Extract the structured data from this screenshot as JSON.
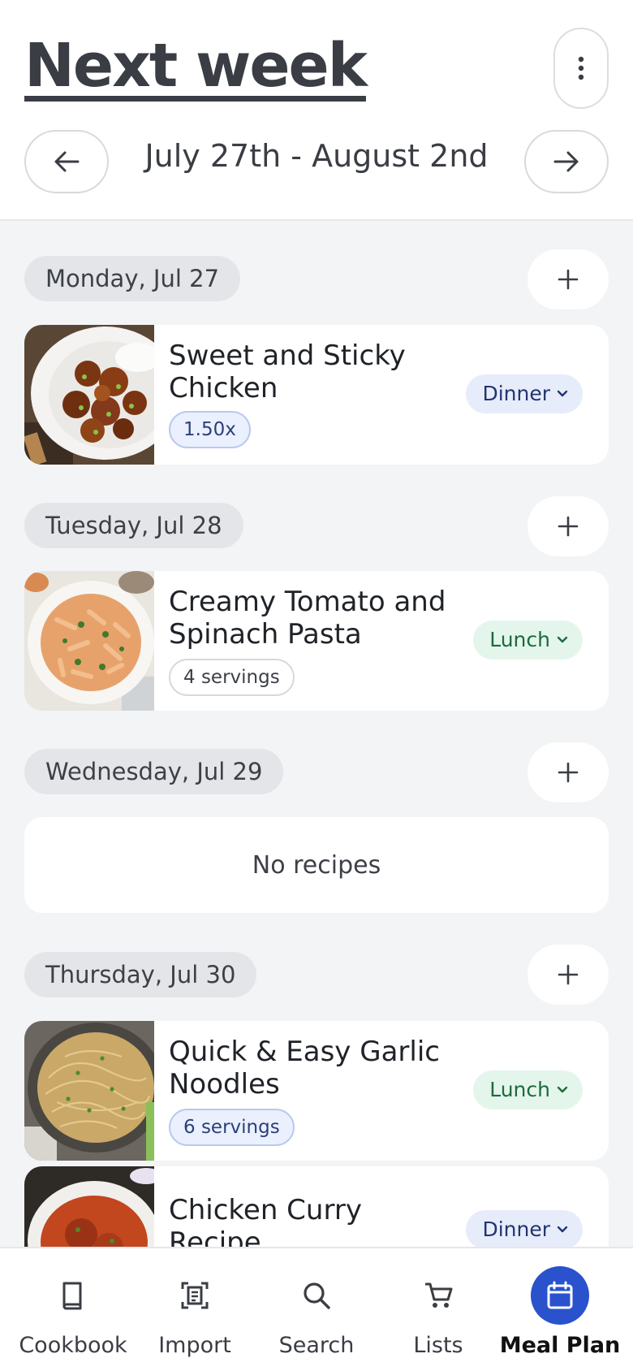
{
  "header": {
    "title": "Next week",
    "week_range": "July 27th - August 2nd",
    "icons": {
      "more": "more-vert-icon",
      "prev": "arrow-left-icon",
      "next": "arrow-right-icon"
    }
  },
  "days": [
    {
      "label": "Monday, Jul 27"
    },
    {
      "label": "Tuesday, Jul 28"
    },
    {
      "label": "Wednesday, Jul 29",
      "empty_text": "No recipes"
    },
    {
      "label": "Thursday, Jul 30"
    }
  ],
  "recipes": [
    {
      "title": "Sweet and Sticky Chicken",
      "chip": "1.50x",
      "meal": "Dinner"
    },
    {
      "title": "Creamy Tomato and Spinach Pasta",
      "chip": "4 servings",
      "meal": "Lunch"
    },
    {
      "title": "Quick & Easy Garlic Noodles",
      "chip": "6 servings",
      "meal": "Lunch"
    },
    {
      "title": "Chicken Curry Recipe",
      "chip": "",
      "meal": "Dinner"
    }
  ],
  "bottom_nav": [
    {
      "label": "Cookbook",
      "icon": "book-icon"
    },
    {
      "label": "Import",
      "icon": "import-scan-icon"
    },
    {
      "label": "Search",
      "icon": "search-icon"
    },
    {
      "label": "Lists",
      "icon": "cart-icon"
    },
    {
      "label": "Meal Plan",
      "icon": "calendar-icon",
      "active": true
    }
  ],
  "colors": {
    "accent": "#2952cc",
    "dinner_tag_bg": "#e7ecfb",
    "lunch_tag_bg": "#e4f6ec",
    "background": "#f3f4f6"
  }
}
